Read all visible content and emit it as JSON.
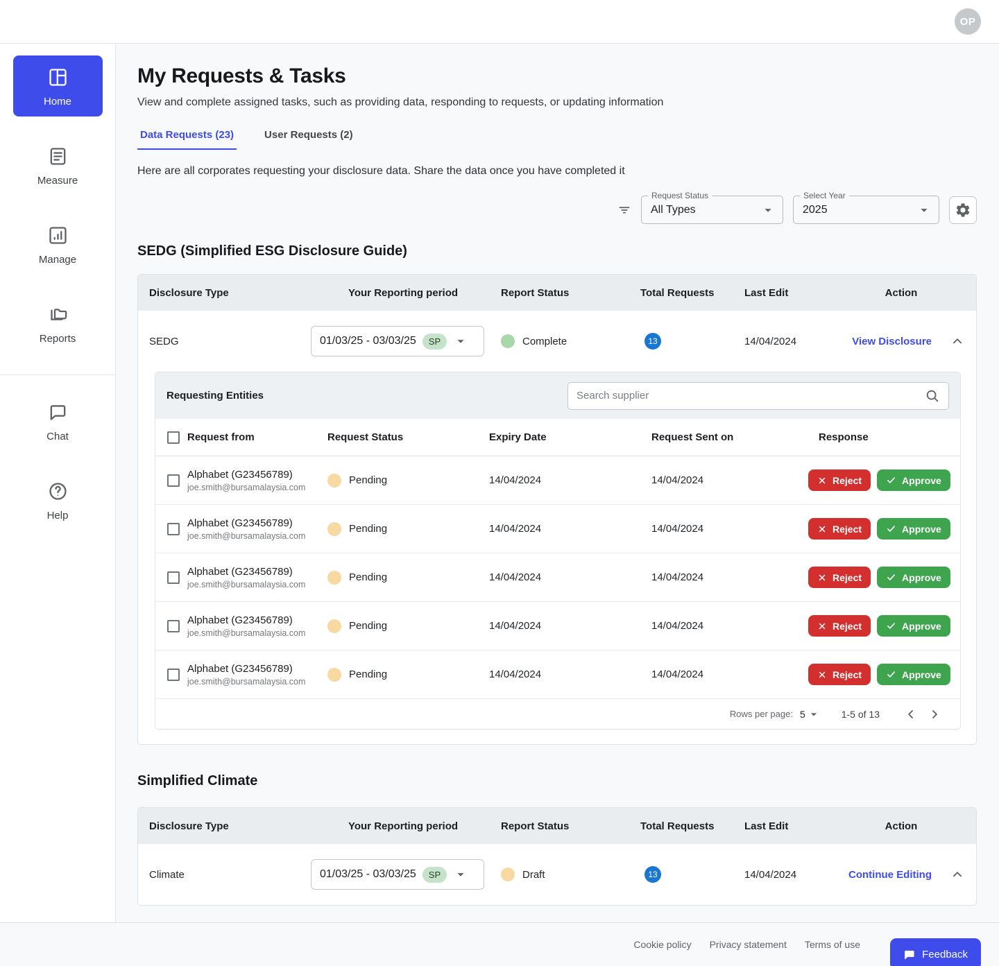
{
  "topbar": {
    "avatar_initials": "OP"
  },
  "sidebar": {
    "items": [
      {
        "label": "Home",
        "icon": "home-dashboard-icon",
        "active": true
      },
      {
        "label": "Measure",
        "icon": "measure-document-icon",
        "active": false
      },
      {
        "label": "Manage",
        "icon": "manage-chart-icon",
        "active": false
      },
      {
        "label": "Reports",
        "icon": "reports-folder-icon",
        "active": false
      },
      {
        "label": "Chat",
        "icon": "chat-bubble-icon",
        "active": false
      }
    ],
    "help": {
      "label": "Help",
      "icon": "help-question-icon"
    }
  },
  "header": {
    "title": "My Requests & Tasks",
    "subtitle": "View and complete assigned tasks, such as providing data, responding to requests, or updating information"
  },
  "tabs": [
    {
      "label": "Data Requests (23)",
      "active": true
    },
    {
      "label": "User Requests (2)",
      "active": false
    }
  ],
  "description": "Here are all corporates requesting your disclosure data. Share the data once you have completed it",
  "filters": {
    "request_status": {
      "label": "Request Status",
      "value": "All Types"
    },
    "select_year": {
      "label": "Select Year",
      "value": "2025"
    }
  },
  "sedg_section": {
    "title": "SEDG (Simplified ESG Disclosure Guide)",
    "table": {
      "columns": [
        "Disclosure Type",
        "Your Reporting period",
        "Report Status",
        "Total Requests",
        "Last Edit",
        "Action"
      ],
      "row": {
        "disclosure_type": "SEDG",
        "reporting_period": "01/03/25 - 03/03/25",
        "period_tag": "SP",
        "report_status": "Complete",
        "total_requests": "13",
        "last_edit": "14/04/2024",
        "action": "View Disclosure"
      }
    },
    "requesting_entities": {
      "title": "Requesting Entities",
      "search_placeholder": "Search supplier",
      "columns": [
        "Request from",
        "Request Status",
        "Expiry Date",
        "Request Sent on",
        "Response"
      ],
      "reject_label": "Reject",
      "approve_label": "Approve",
      "rows": [
        {
          "name": "Alphabet (G23456789)",
          "email": "joe.smith@bursamalaysia.com",
          "status": "Pending",
          "expiry": "14/04/2024",
          "sent": "14/04/2024"
        },
        {
          "name": "Alphabet (G23456789)",
          "email": "joe.smith@bursamalaysia.com",
          "status": "Pending",
          "expiry": "14/04/2024",
          "sent": "14/04/2024"
        },
        {
          "name": "Alphabet (G23456789)",
          "email": "joe.smith@bursamalaysia.com",
          "status": "Pending",
          "expiry": "14/04/2024",
          "sent": "14/04/2024"
        },
        {
          "name": "Alphabet (G23456789)",
          "email": "joe.smith@bursamalaysia.com",
          "status": "Pending",
          "expiry": "14/04/2024",
          "sent": "14/04/2024"
        },
        {
          "name": "Alphabet (G23456789)",
          "email": "joe.smith@bursamalaysia.com",
          "status": "Pending",
          "expiry": "14/04/2024",
          "sent": "14/04/2024"
        }
      ],
      "pagination": {
        "rows_per_page_label": "Rows per page:",
        "rows_per_page": "5",
        "range": "1-5 of 13"
      }
    }
  },
  "climate_section": {
    "title": "Simplified Climate",
    "table": {
      "columns": [
        "Disclosure Type",
        "Your Reporting period",
        "Report Status",
        "Total Requests",
        "Last Edit",
        "Action"
      ],
      "row": {
        "disclosure_type": "Climate",
        "reporting_period": "01/03/25 - 03/03/25",
        "period_tag": "SP",
        "report_status": "Draft",
        "total_requests": "13",
        "last_edit": "14/04/2024",
        "action": "Continue Editing"
      }
    }
  },
  "footer": {
    "links": [
      "Cookie policy",
      "Privacy statement",
      "Terms of use"
    ],
    "feedback_label": "Feedback"
  },
  "colors": {
    "accent_blue": "#3D4CEB",
    "badge_blue": "#1976D2",
    "approve_green": "#3EA44D",
    "reject_red": "#D32F2F",
    "complete_dot": "#A9D7AC",
    "pending_dot": "#F8D9A2",
    "sp_pill": "#C5E3C9",
    "table_header_bg": "#E9EDF0"
  }
}
